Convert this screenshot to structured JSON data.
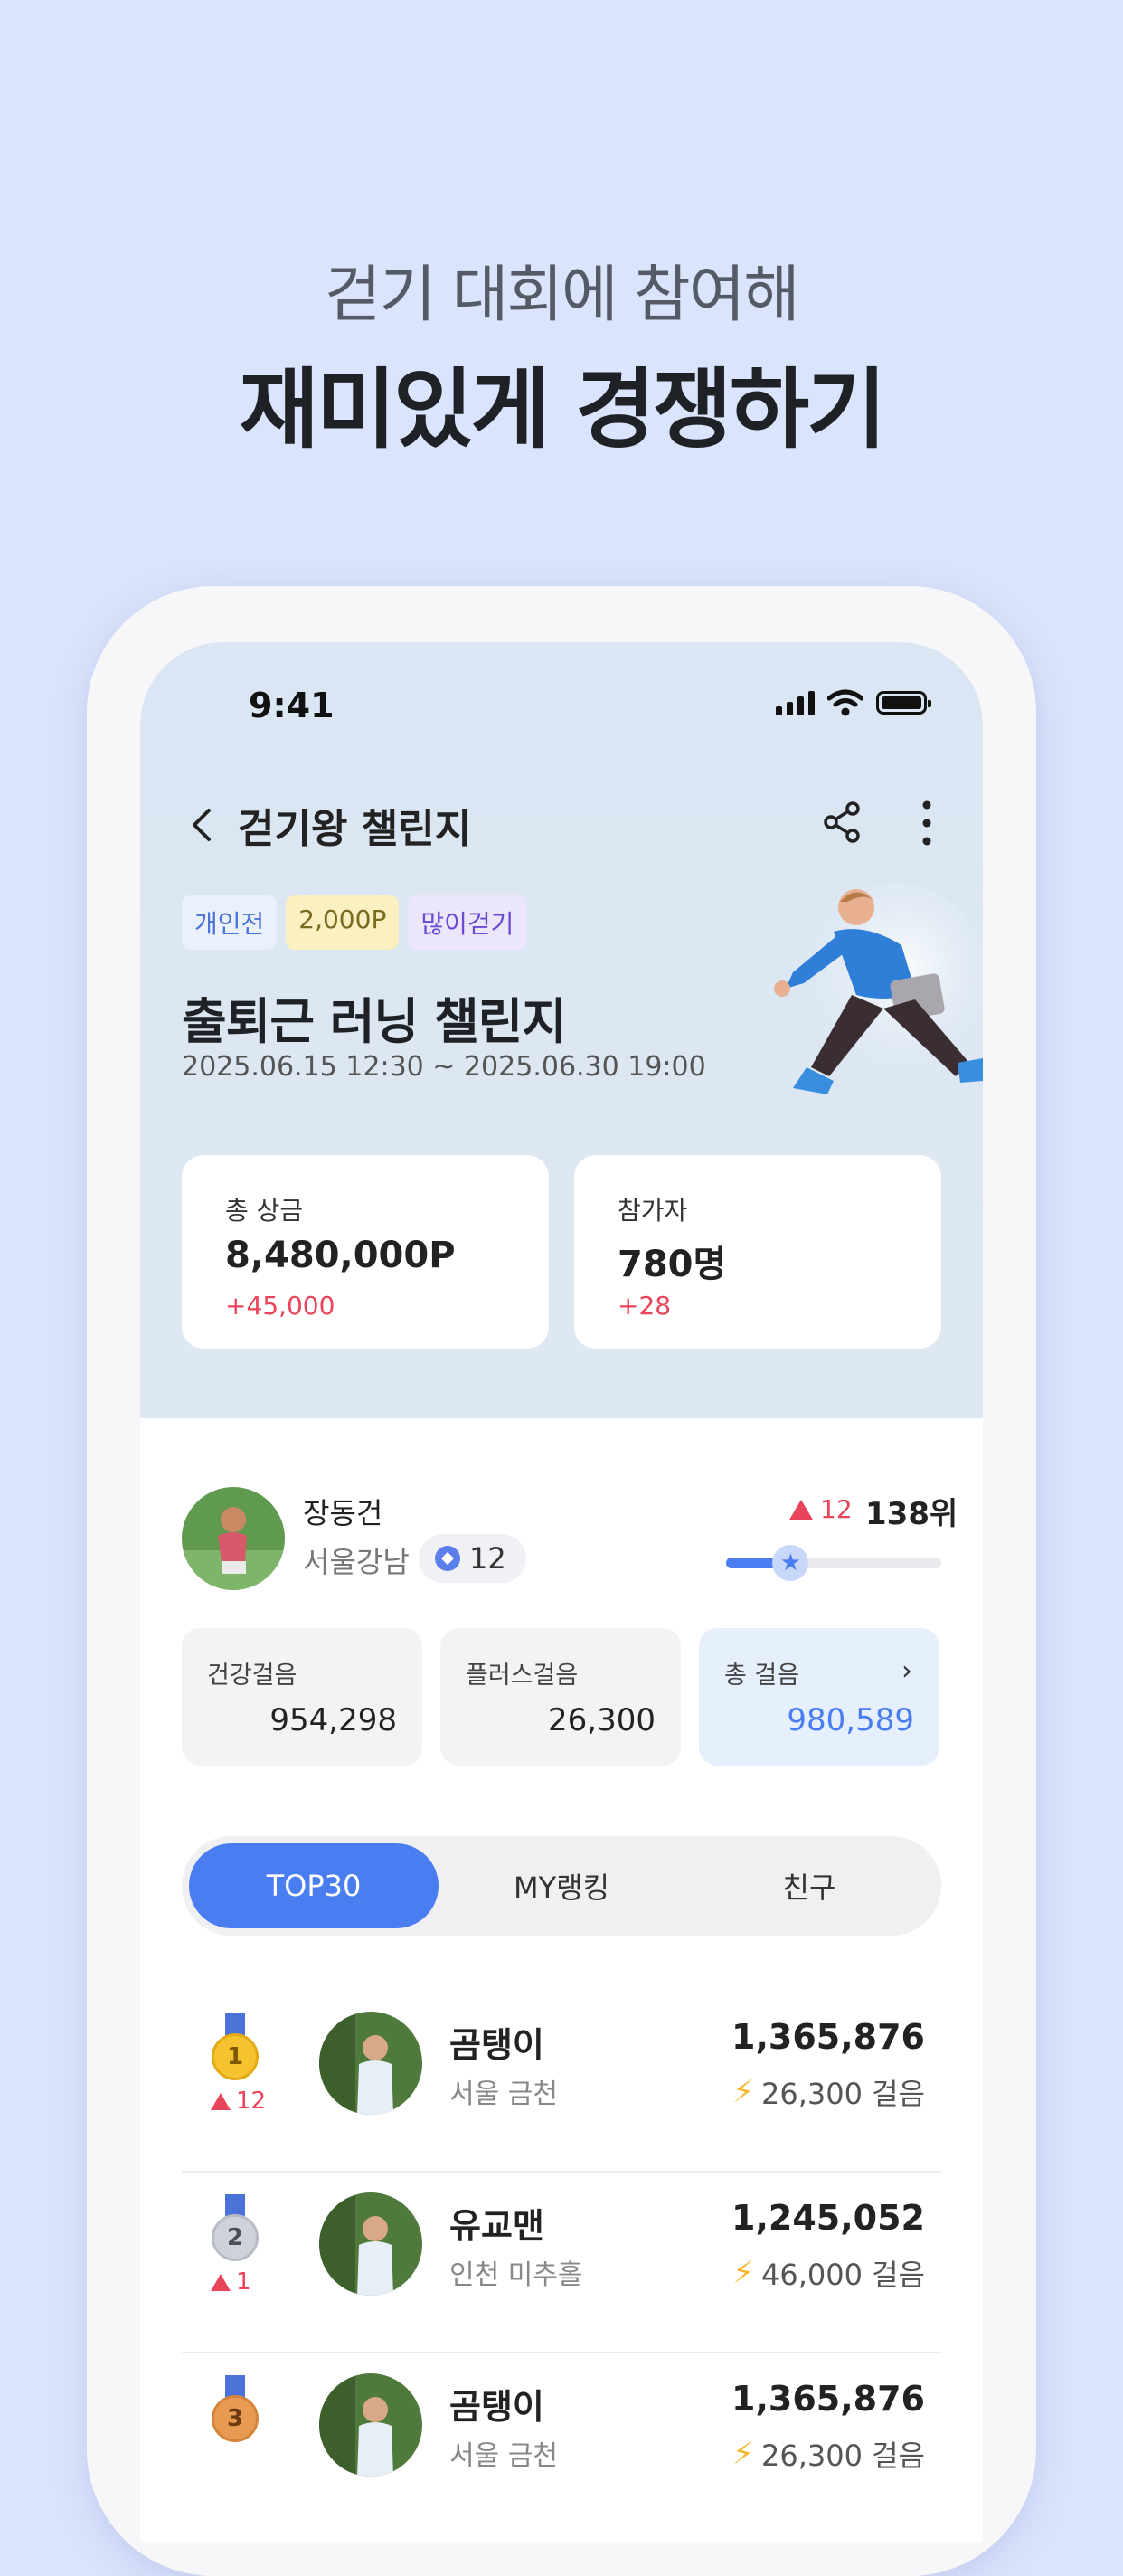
{
  "promo": {
    "subtitle": "걷기 대회에 참여해",
    "title": "재미있게 경쟁하기"
  },
  "status_bar": {
    "time": "9:41"
  },
  "nav": {
    "title": "걷기왕 챌린지",
    "back_icon": "chevron-left-icon",
    "share_icon": "share-icon",
    "more_icon": "more-vertical-icon"
  },
  "challenge": {
    "tags": [
      "개인전",
      "2,000P",
      "많이걷기"
    ],
    "title": "출퇴근 러닝 챌린지",
    "period": "2025.06.15 12:30 ~ 2025.06.30 19:00"
  },
  "stats": [
    {
      "label": "총 상금",
      "value": "8,480,000P",
      "delta": "+45,000"
    },
    {
      "label": "참가자",
      "value": "780명",
      "delta": "+28"
    }
  ],
  "me": {
    "name": "장동건",
    "region": "서울강남",
    "badge_count": "12",
    "rank_change": "12",
    "rank": "138위",
    "progress_fraction": 0.3
  },
  "steps": [
    {
      "label": "건강걸음",
      "value": "954,298"
    },
    {
      "label": "플러스걸음",
      "value": "26,300"
    },
    {
      "label": "총 걸음",
      "value": "980,589"
    }
  ],
  "tabs": [
    "TOP30",
    "MY랭킹",
    "친구"
  ],
  "active_tab": "TOP30",
  "ranking": [
    {
      "rank": "1",
      "rank_change": "12",
      "name": "곰탱이",
      "region": "서울 금천",
      "total": "1,365,876",
      "steps": "26,300 걸음"
    },
    {
      "rank": "2",
      "rank_change": "1",
      "name": "유교맨",
      "region": "인천 미추홀",
      "total": "1,245,052",
      "steps": "46,000 걸음"
    },
    {
      "rank": "3",
      "rank_change": "",
      "name": "곰탱이",
      "region": "서울 금천",
      "total": "1,365,876",
      "steps": "26,300 걸음"
    }
  ],
  "colors": {
    "background": "#dbe4fd",
    "accent": "#4a7ef0",
    "delta_red": "#e8445a",
    "hero": "#dae6f3"
  }
}
